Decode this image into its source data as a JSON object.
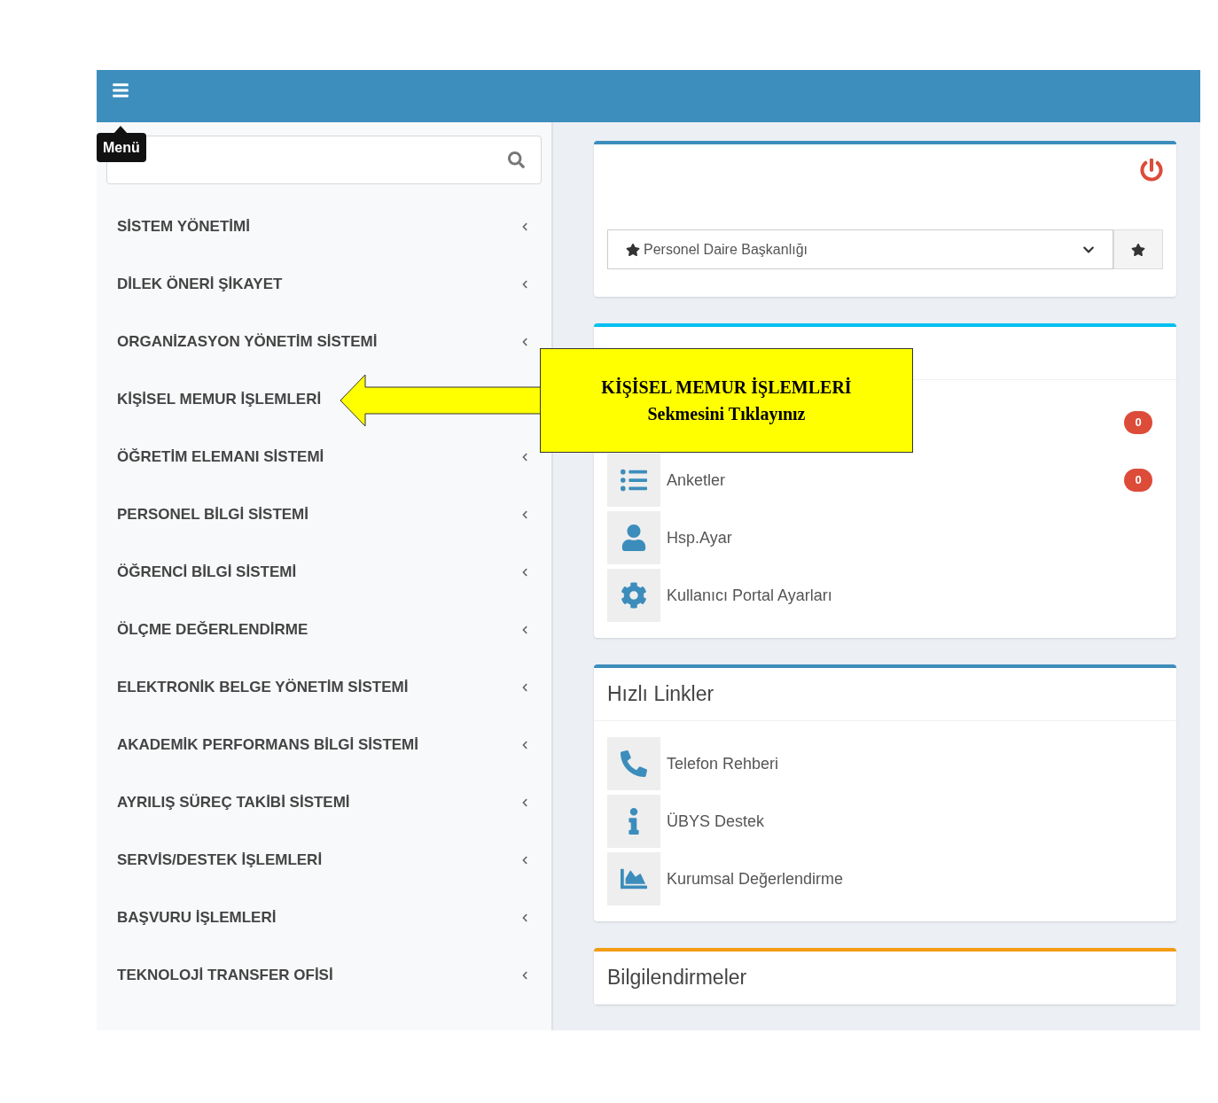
{
  "header": {
    "menu_tooltip": "Menü"
  },
  "sidebar": {
    "items": [
      {
        "label": "SİSTEM YÖNETİMİ",
        "expandable": true
      },
      {
        "label": "DİLEK ÖNERİ ŞİKAYET",
        "expandable": true
      },
      {
        "label": "ORGANİZASYON YÖNETİM SİSTEMİ",
        "expandable": true
      },
      {
        "label": "KİŞİSEL MEMUR İŞLEMLERİ",
        "expandable": false
      },
      {
        "label": "ÖĞRETİM ELEMANI SİSTEMİ",
        "expandable": true
      },
      {
        "label": "PERSONEL BİLGİ SİSTEMİ",
        "expandable": true
      },
      {
        "label": "ÖĞRENCİ BİLGİ SİSTEMİ",
        "expandable": true
      },
      {
        "label": "ÖLÇME DEĞERLENDİRME",
        "expandable": true
      },
      {
        "label": "ELEKTRONİK BELGE YÖNETİM SİSTEMİ",
        "expandable": true
      },
      {
        "label": "AKADEMİK PERFORMANS BİLGİ SİSTEMİ",
        "expandable": true
      },
      {
        "label": "AYRILIŞ SÜREÇ TAKİBİ SİSTEMİ",
        "expandable": true
      },
      {
        "label": "SERVİS/DESTEK İŞLEMLERİ",
        "expandable": true
      },
      {
        "label": "BAŞVURU İŞLEMLERİ",
        "expandable": true
      },
      {
        "label": "TEKNOLOJİ TRANSFER OFİSİ",
        "expandable": true
      }
    ]
  },
  "top_card": {
    "unit_select": {
      "value": "Personel Daire Başkanlığı"
    }
  },
  "cards": [
    {
      "color": "#00c0ef",
      "items": [
        {
          "badge": "0"
        },
        {
          "label": "Anketler",
          "badge": "0"
        },
        {
          "label": "Hsp.Ayar"
        },
        {
          "label": "Kullanıcı Portal Ayarları"
        }
      ]
    },
    {
      "color": "#3c8dbc",
      "title": "Hızlı Linkler",
      "items": [
        {
          "label": "Telefon Rehberi"
        },
        {
          "label": "ÜBYS Destek"
        },
        {
          "label": "Kurumsal Değerlendirme"
        }
      ]
    },
    {
      "color": "#f39c12",
      "title": "Bilgilendirmeler"
    }
  ],
  "callout": {
    "lines": [
      "KİŞİSEL MEMUR İŞLEMLERİ",
      "Sekmesini Tıklayınız"
    ]
  }
}
